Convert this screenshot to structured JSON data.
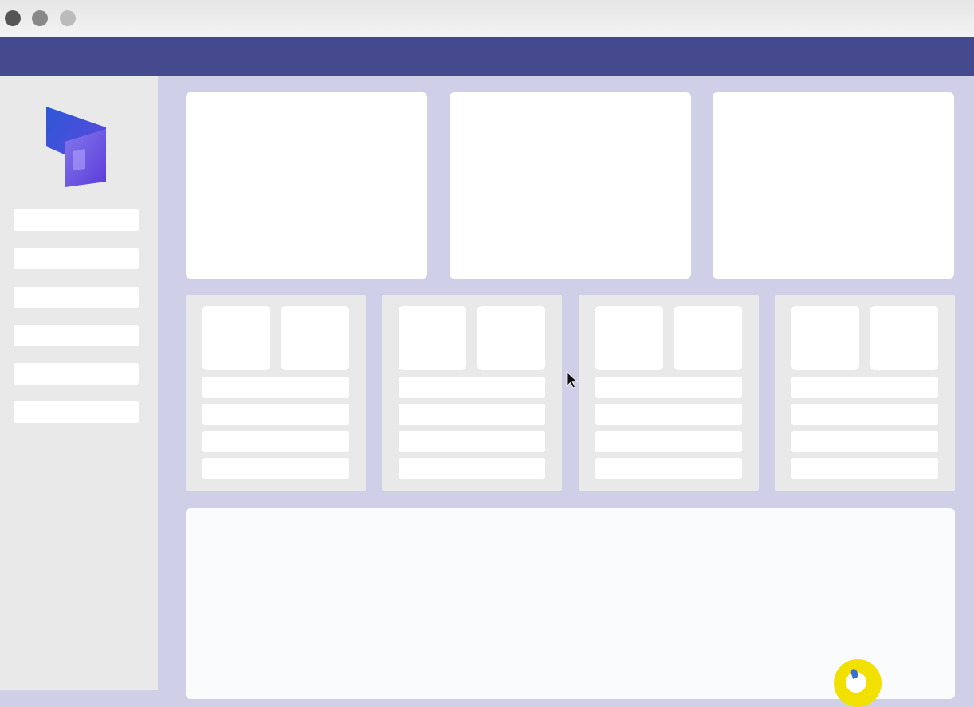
{
  "window": {
    "controls": [
      "close-control",
      "minimize-control",
      "maximize-control"
    ]
  },
  "app": {
    "logo_icon": "dynamics-365-logo-icon",
    "colors": {
      "appbar": "#45498e",
      "background": "#cfd0e8",
      "sidebar": "#e9e9e9",
      "card": "#ffffff",
      "logo_dark": "#3a3fd0",
      "logo_light": "#8f7ff0",
      "pointer_highlight": "#f2e000"
    }
  },
  "sidebar": {
    "items": [
      {},
      {},
      {},
      {},
      {},
      {}
    ]
  },
  "main": {
    "top_cards": [
      {},
      {},
      {}
    ],
    "mid_cards": [
      {
        "lines": [
          {},
          {},
          {},
          {}
        ]
      },
      {
        "lines": [
          {},
          {},
          {},
          {}
        ]
      },
      {
        "lines": [
          {},
          {},
          {},
          {}
        ]
      },
      {
        "lines": [
          {},
          {},
          {},
          {}
        ]
      }
    ],
    "bottom_panel": {}
  },
  "overlay": {
    "cursor_icon": "mouse-pointer-icon",
    "click_highlight_icon": "click-indicator-icon"
  }
}
